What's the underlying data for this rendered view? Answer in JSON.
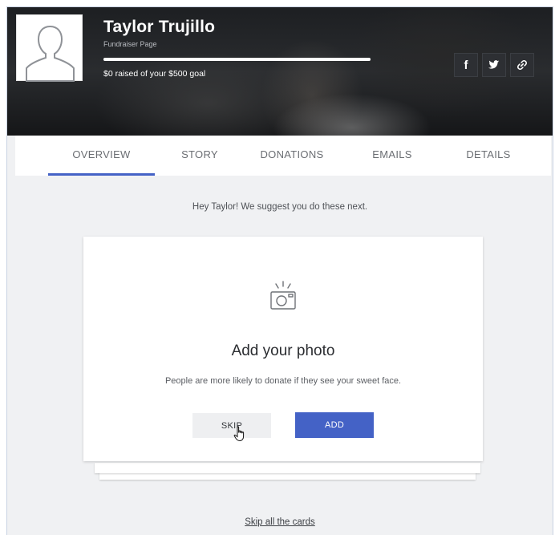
{
  "profile": {
    "name": "Taylor Trujillo",
    "page_type": "Fundraiser Page",
    "goal_text": "$0 raised of your $500 goal",
    "progress_fraction": 0
  },
  "social": [
    {
      "id": "facebook",
      "glyph": "f",
      "icon": "facebook-icon"
    },
    {
      "id": "twitter",
      "glyph": "twitter",
      "icon": "twitter-icon"
    },
    {
      "id": "link",
      "glyph": "link",
      "icon": "link-icon"
    }
  ],
  "tabs": [
    {
      "label": "OVERVIEW",
      "active": true
    },
    {
      "label": "STORY",
      "active": false
    },
    {
      "label": "DONATIONS",
      "active": false
    },
    {
      "label": "EMAILS",
      "active": false
    },
    {
      "label": "DETAILS",
      "active": false
    }
  ],
  "main": {
    "suggestion": "Hey Taylor! We suggest you do these next.",
    "card": {
      "icon": "camera-icon",
      "title": "Add your photo",
      "description": "People are more likely to donate if they see your sweet face.",
      "skip_label": "SKIP",
      "add_label": "ADD"
    },
    "skip_all_label": "Skip all the cards"
  },
  "colors": {
    "accent": "#4462c6",
    "hero_bg": "#1d1f22",
    "page_bg": "#f0f1f3"
  }
}
